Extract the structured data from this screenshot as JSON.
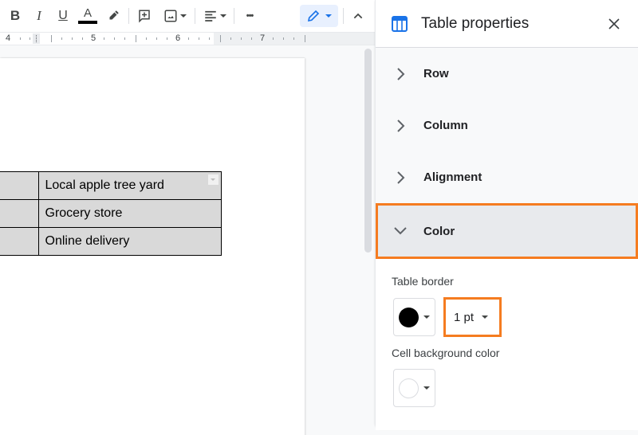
{
  "toolbar": {
    "bold": "B",
    "italic": "I",
    "underline": "U",
    "text_color": "A",
    "text_color_value": "#000000",
    "more": "•••"
  },
  "ruler": {
    "numbers": [
      "4",
      "5",
      "6",
      "7"
    ]
  },
  "document": {
    "table_rows": [
      {
        "col1": "",
        "col2": "Local apple tree yard"
      },
      {
        "col1": "",
        "col2": "Grocery store"
      },
      {
        "col1": "",
        "col2": "Online delivery"
      }
    ]
  },
  "panel": {
    "title": "Table properties",
    "sections": [
      {
        "label": "Row",
        "expanded": false
      },
      {
        "label": "Column",
        "expanded": false
      },
      {
        "label": "Alignment",
        "expanded": false
      },
      {
        "label": "Color",
        "expanded": true
      }
    ],
    "color": {
      "table_border_label": "Table border",
      "border_color": "#000000",
      "border_width": "1 pt",
      "cell_bg_label": "Cell background color",
      "cell_bg_color": "#ffffff"
    }
  },
  "colors": {
    "accent": "#1a73e8",
    "highlight": "#f57c20",
    "mode_button_bg": "#e8f0fe"
  }
}
